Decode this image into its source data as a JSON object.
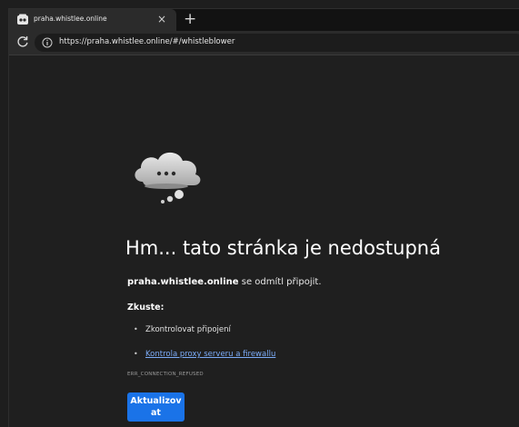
{
  "tab": {
    "title": "praha.whistlee.online",
    "close_glyph": "×",
    "new_tab_glyph": "+"
  },
  "toolbar": {
    "url": "https://praha.whistlee.online/#/whistleblower"
  },
  "error_page": {
    "headline": "Hm... tato stránka je nedostupná",
    "host": "praha.whistlee.online",
    "refused_text": " se odmítl připojit.",
    "try_label": "Zkuste:",
    "suggestions": [
      {
        "text": "Zkontrolovat připojení",
        "link": false
      },
      {
        "text": "Kontrola proxy serveru a firewallu",
        "link": true
      }
    ],
    "error_code": "ERR_CONNECTION_REFUSED",
    "reload_button": "Aktualizovat"
  },
  "colors": {
    "background": "#1f1f1f",
    "link": "#7cacf8",
    "button": "#1a73e8"
  },
  "icons": {
    "favicon": "mask-logo-icon",
    "reload": "reload-icon",
    "info": "info-icon",
    "illustration": "sad-cloud-icon"
  }
}
